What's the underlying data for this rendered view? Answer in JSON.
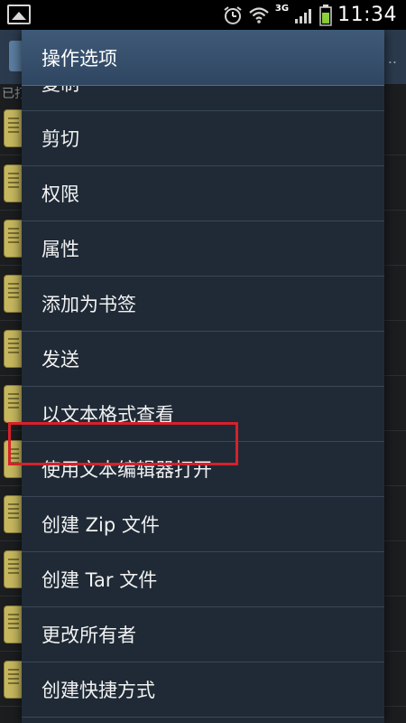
{
  "status_bar": {
    "network": "3G",
    "time": "11:34"
  },
  "background": {
    "path_prefix": "已打",
    "overflow": ".."
  },
  "dialog": {
    "title": "操作选项",
    "items": [
      {
        "label": "复制"
      },
      {
        "label": "剪切"
      },
      {
        "label": "权限"
      },
      {
        "label": "属性"
      },
      {
        "label": "添加为书签"
      },
      {
        "label": "发送"
      },
      {
        "label": "以文本格式查看"
      },
      {
        "label": "使用文本编辑器打开"
      },
      {
        "label": "创建 Zip 文件"
      },
      {
        "label": "创建 Tar 文件"
      },
      {
        "label": "更改所有者"
      },
      {
        "label": "创建快捷方式"
      }
    ]
  },
  "colors": {
    "dialog_bg": "#1f2a36",
    "title_bg": "#3f5a78",
    "highlight": "#d9202a"
  }
}
